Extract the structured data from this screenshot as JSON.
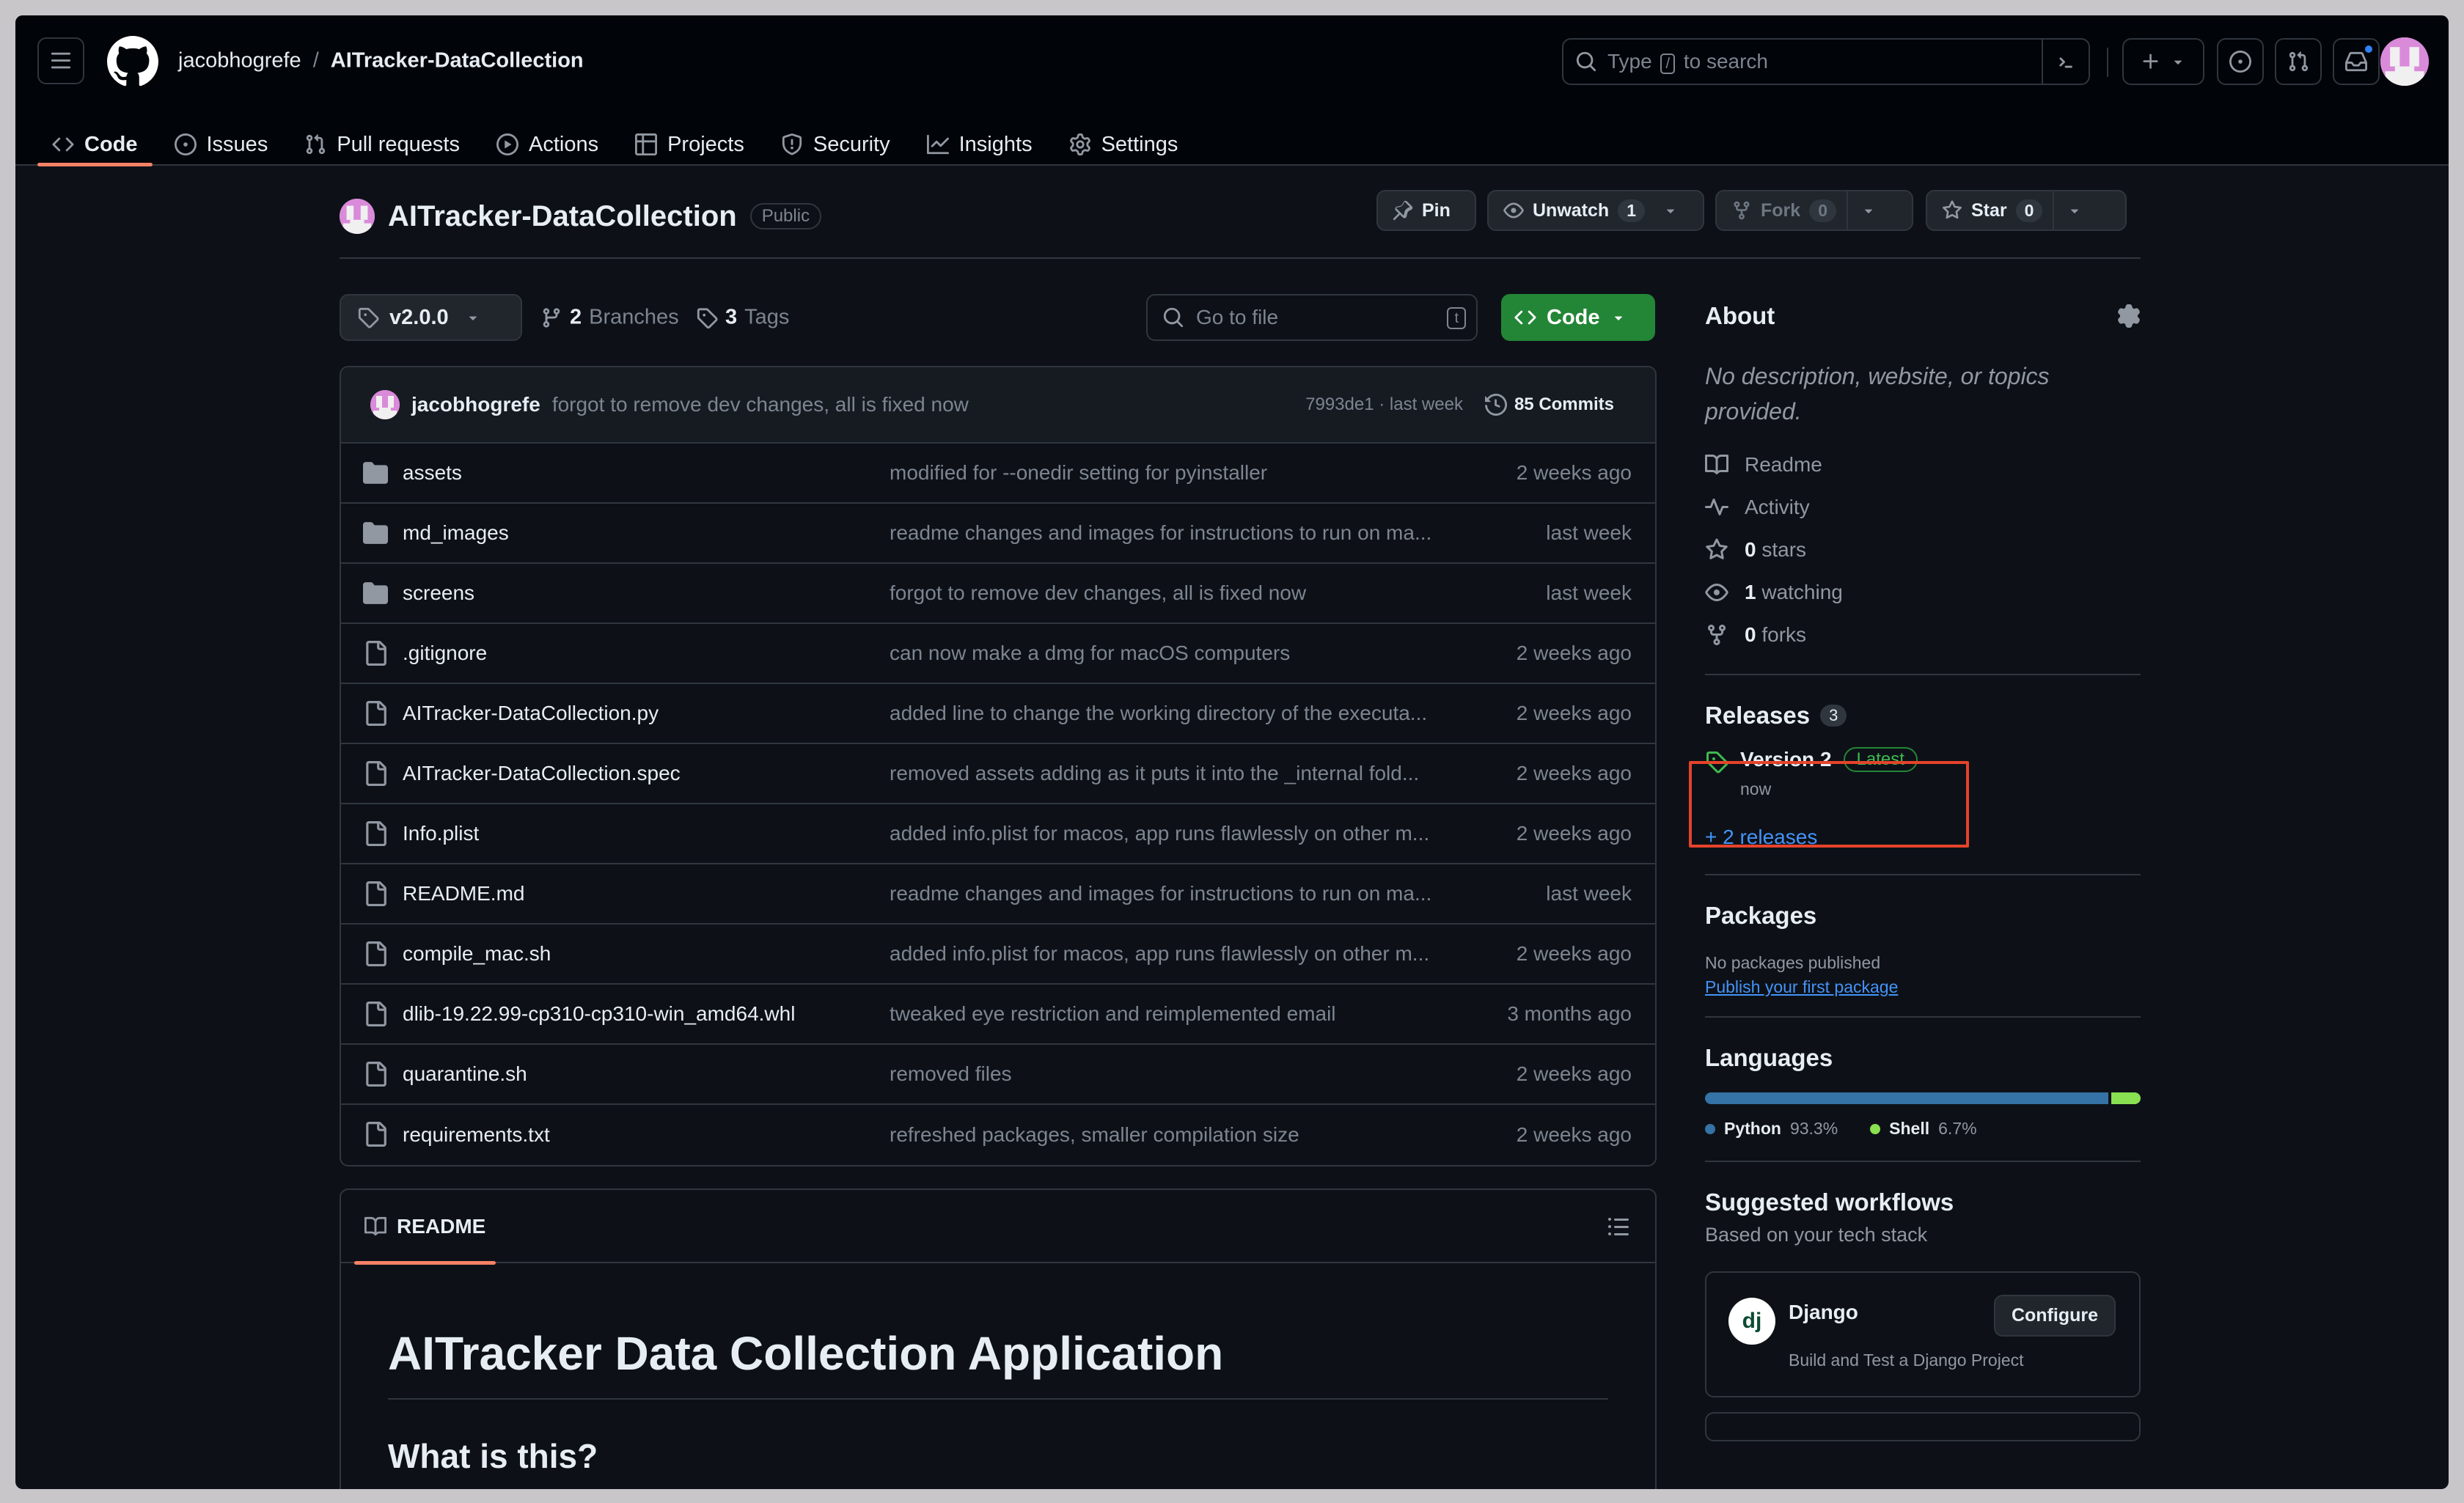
{
  "header": {
    "owner": "jacobhogrefe",
    "separator": "/",
    "repo": "AITracker-DataCollection",
    "search_prefix": "Type",
    "search_key": "/",
    "search_suffix": "to search"
  },
  "tabs": [
    {
      "label": "Code",
      "icon": "code-icon",
      "active": true
    },
    {
      "label": "Issues",
      "icon": "issue-icon"
    },
    {
      "label": "Pull requests",
      "icon": "pull-request-icon"
    },
    {
      "label": "Actions",
      "icon": "play-icon"
    },
    {
      "label": "Projects",
      "icon": "table-icon"
    },
    {
      "label": "Security",
      "icon": "shield-icon"
    },
    {
      "label": "Insights",
      "icon": "graph-icon"
    },
    {
      "label": "Settings",
      "icon": "gear-icon"
    }
  ],
  "repo": {
    "name": "AITracker-DataCollection",
    "visibility": "Public",
    "pin_label": "Pin",
    "unwatch_label": "Unwatch",
    "watch_count": "1",
    "fork_label": "Fork",
    "fork_count": "0",
    "star_label": "Star",
    "star_count": "0"
  },
  "toolbar": {
    "branch": "v2.0.0",
    "branches_count": "2",
    "branches_label": "Branches",
    "tags_count": "3",
    "tags_label": "Tags",
    "goto_placeholder": "Go to file",
    "goto_key": "t",
    "code_label": "Code"
  },
  "latest_commit": {
    "author": "jacobhogrefe",
    "message": "forgot to remove dev changes, all is fixed now",
    "hash_time": "7993de1 · last week",
    "commits_label": "85 Commits"
  },
  "files": [
    {
      "type": "dir",
      "name": "assets",
      "message": "modified for --onedir setting for pyinstaller",
      "date": "2 weeks ago"
    },
    {
      "type": "dir",
      "name": "md_images",
      "message": "readme changes and images for instructions to run on ma...",
      "date": "last week"
    },
    {
      "type": "dir",
      "name": "screens",
      "message": "forgot to remove dev changes, all is fixed now",
      "date": "last week"
    },
    {
      "type": "file",
      "name": ".gitignore",
      "message": "can now make a dmg for macOS computers",
      "date": "2 weeks ago"
    },
    {
      "type": "file",
      "name": "AITracker-DataCollection.py",
      "message": "added line to change the working directory of the executa...",
      "date": "2 weeks ago"
    },
    {
      "type": "file",
      "name": "AITracker-DataCollection.spec",
      "message": "removed assets adding as it puts it into the _internal fold...",
      "date": "2 weeks ago"
    },
    {
      "type": "file",
      "name": "Info.plist",
      "message": "added info.plist for macos, app runs flawlessly on other m...",
      "date": "2 weeks ago"
    },
    {
      "type": "file",
      "name": "README.md",
      "message": "readme changes and images for instructions to run on ma...",
      "date": "last week"
    },
    {
      "type": "file",
      "name": "compile_mac.sh",
      "message": "added info.plist for macos, app runs flawlessly on other m...",
      "date": "2 weeks ago"
    },
    {
      "type": "file",
      "name": "dlib-19.22.99-cp310-cp310-win_amd64.whl",
      "message": "tweaked eye restriction and reimplemented email",
      "date": "3 months ago"
    },
    {
      "type": "file",
      "name": "quarantine.sh",
      "message": "removed files",
      "date": "2 weeks ago"
    },
    {
      "type": "file",
      "name": "requirements.txt",
      "message": "refreshed packages, smaller compilation size",
      "date": "2 weeks ago"
    }
  ],
  "readme": {
    "tab_label": "README",
    "h1": "AITracker Data Collection Application",
    "h2": "What is this?"
  },
  "about": {
    "title": "About",
    "description": "No description, website, or topics provided.",
    "links": [
      {
        "icon": "book-icon",
        "label": "Readme",
        "count": ""
      },
      {
        "icon": "pulse-icon",
        "label": "Activity",
        "count": ""
      },
      {
        "icon": "star-icon",
        "label": "stars",
        "count": "0"
      },
      {
        "icon": "eye-icon",
        "label": "watching",
        "count": "1"
      },
      {
        "icon": "fork-icon",
        "label": "forks",
        "count": "0"
      }
    ]
  },
  "releases": {
    "title": "Releases",
    "count": "3",
    "latest_name": "Version 2",
    "latest_badge": "Latest",
    "latest_time": "now",
    "more_label": "+ 2 releases"
  },
  "packages": {
    "title": "Packages",
    "empty_text": "No packages published",
    "link": "Publish your first package"
  },
  "languages": {
    "title": "Languages",
    "items": [
      {
        "name": "Python",
        "percent": "93.3%",
        "value": 93.3,
        "color": "#3572A5"
      },
      {
        "name": "Shell",
        "percent": "6.7%",
        "value": 6.7,
        "color": "#89e051"
      }
    ]
  },
  "workflows": {
    "title": "Suggested workflows",
    "subtitle": "Based on your tech stack",
    "card_name": "Django",
    "card_logo": "dj",
    "card_desc": "Build and Test a Django Project",
    "configure_label": "Configure"
  },
  "colors": {
    "accent_tab": "#f78166",
    "primary_button": "#238636",
    "link": "#4493f8",
    "highlight_box": "#e5432b"
  }
}
